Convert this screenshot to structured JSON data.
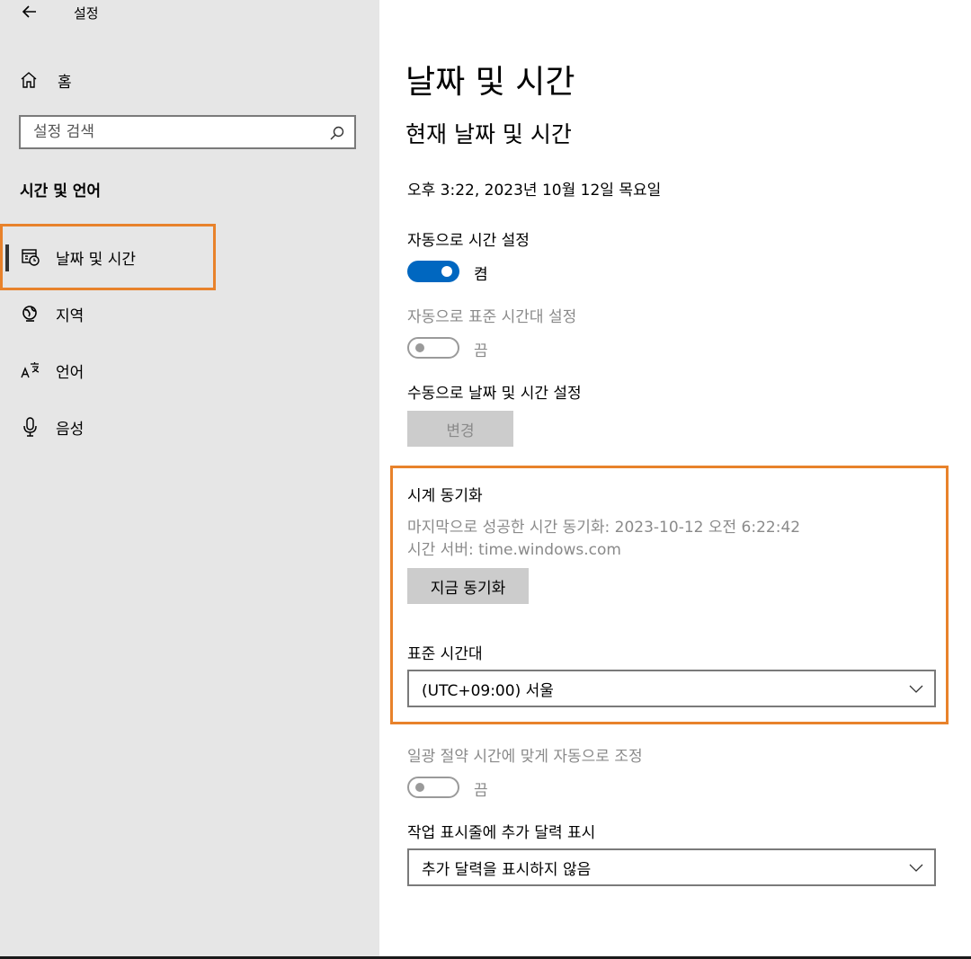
{
  "app": {
    "title": "설정"
  },
  "sidebar": {
    "home_label": "홈",
    "search_placeholder": "설정 검색",
    "section_title": "시간 및 언어",
    "items": [
      {
        "label": "날짜 및 시간",
        "icon": "calendar-clock-icon",
        "active": true
      },
      {
        "label": "지역",
        "icon": "region-globe-icon"
      },
      {
        "label": "언어",
        "icon": "language-icon"
      },
      {
        "label": "음성",
        "icon": "microphone-icon"
      }
    ]
  },
  "main": {
    "title": "날짜 및 시간",
    "subtitle": "현재 날짜 및 시간",
    "current_datetime": "오후 3:22, 2023년 10월 12일 목요일",
    "auto_time": {
      "label": "자동으로 시간 설정",
      "state": "켬",
      "on": true
    },
    "auto_timezone": {
      "label": "자동으로 표준 시간대 설정",
      "state": "끔",
      "on": false,
      "disabled": true
    },
    "manual": {
      "label": "수동으로 날짜 및 시간 설정",
      "button": "변경"
    },
    "sync": {
      "title": "시계 동기화",
      "last_sync": "마지막으로 성공한 시간 동기화: 2023-10-12 오전 6:22:42",
      "server": "시간 서버: time.windows.com",
      "button": "지금 동기화"
    },
    "timezone": {
      "label": "표준 시간대",
      "value": "(UTC+09:00) 서울"
    },
    "dst": {
      "label": "일광 절약 시간에 맞게 자동으로 조정",
      "state": "끔",
      "on": false,
      "disabled": true
    },
    "calendar": {
      "label": "작업 표시줄에 추가 달력 표시",
      "value": "추가 달력을 표시하지 않음"
    }
  },
  "colors": {
    "accent": "#0067c0",
    "highlight": "#e8822b",
    "sidebar_bg": "#e6e6e6"
  }
}
